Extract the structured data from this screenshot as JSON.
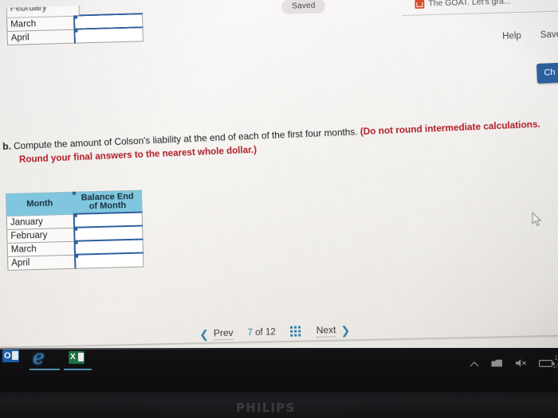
{
  "browser": {
    "tab_title": "The GOAT. Let's gra...",
    "favicon": "red-document-icon"
  },
  "status": {
    "saved_badge": "Saved"
  },
  "toolbar": {
    "help_label": "Help",
    "save_label": "Save",
    "check_button_label": "Ch"
  },
  "question": {
    "part_label": "b.",
    "line1_main": "Compute the amount of Colson's liability at the end of each of the first four months.",
    "line1_red": "(Do not round intermediate calculations.",
    "line2_red": "Round your final answers to the nearest whole dollar.)"
  },
  "table_top": {
    "clipped_row_label": "February",
    "rows": [
      {
        "month": "March",
        "value": ""
      },
      {
        "month": "April",
        "value": ""
      }
    ]
  },
  "table_bottom": {
    "headers": [
      "Month",
      "Balance End of Month"
    ],
    "header_line1": "Balance End",
    "header_line2": "of Month",
    "header_color": "#7fc6de",
    "rows": [
      {
        "month": "January",
        "value": ""
      },
      {
        "month": "February",
        "value": ""
      },
      {
        "month": "March",
        "value": ""
      },
      {
        "month": "April",
        "value": ""
      }
    ]
  },
  "navigation": {
    "prev_label": "Prev",
    "next_label": "Next",
    "current_page": "7",
    "of_label": "of",
    "total_pages": "12",
    "grid_icon": "grid-view-icon"
  },
  "taskbar": {
    "apps": [
      {
        "name": "outlook",
        "glyph": "O"
      },
      {
        "name": "internet-explorer",
        "glyph": "e"
      },
      {
        "name": "excel",
        "glyph": "X"
      }
    ],
    "tray": [
      "chevron-up-icon",
      "network-icon",
      "volume-mute-icon",
      "battery-icon"
    ],
    "clock_line1": "1",
    "clock_line2": "1/"
  },
  "monitor": {
    "brand": "PHILIPS"
  },
  "colors": {
    "accent_blue": "#2f5f9e",
    "table_header_blue": "#7fc6de",
    "link_blue": "#2f7fa8",
    "red_text": "#b01e28"
  }
}
